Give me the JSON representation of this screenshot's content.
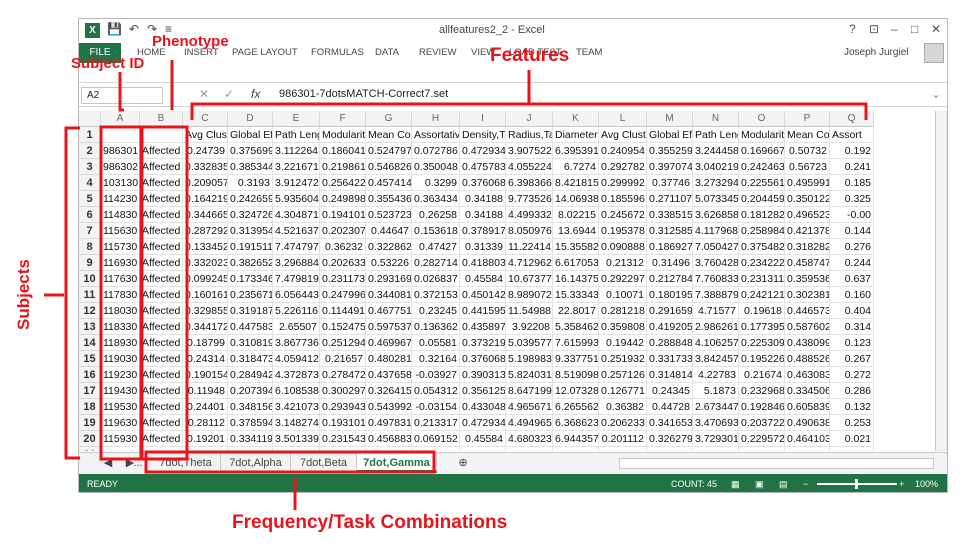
{
  "window": {
    "title": "allfeatures2_2 - Excel",
    "user": "Joseph Jurgiel",
    "controls": [
      "?",
      "⊡",
      "–",
      "□",
      "✕"
    ]
  },
  "quick_access": [
    "💾",
    "↶",
    "↷",
    "≡"
  ],
  "ribbon_tabs": [
    "FILE",
    "HOME",
    "INSERT",
    "PAGE LAYOUT",
    "FORMULAS",
    "DATA",
    "REVIEW",
    "VIEW",
    "LOAD TEST",
    "TEAM"
  ],
  "formula_bar": {
    "name_box": "A2",
    "fx": "fx",
    "value": "986301-7dotsMATCH-Correct7.set"
  },
  "columns": [
    "A",
    "B",
    "C",
    "D",
    "E",
    "F",
    "G",
    "H",
    "I",
    "J",
    "K",
    "L",
    "M",
    "N",
    "O",
    "P",
    "Q"
  ],
  "header_row": [
    "",
    "",
    "Avg Cluste",
    "Global Effi",
    "Path Lengt",
    "Modularity",
    "Mean Coh",
    "Assortativi",
    "Density,Ta",
    "Radius,Tas",
    "Diameter,",
    "Avg Cluste",
    "Global Effi",
    "Path Lengt",
    "Modularity",
    "Mean Coh",
    "Assort"
  ],
  "rows": [
    {
      "n": "2",
      "id": "986301",
      "ph": "Affected",
      "v": [
        "0.24739",
        "0.375699",
        "3.112264",
        "0.186041",
        "0.524797",
        "0.072786",
        "0.472934",
        "3.907522",
        "6.395391",
        "0.240954",
        "0.355259",
        "3.244458",
        "0.169667",
        "0.50732",
        "0.192"
      ]
    },
    {
      "n": "3",
      "id": "986302",
      "ph": "Affected",
      "v": [
        "0.332835",
        "0.385344",
        "3.221671",
        "0.219861",
        "0.546826",
        "0.350048",
        "0.475783",
        "4.055224",
        "6.7274",
        "0.292782",
        "0.397074",
        "3.040219",
        "0.242463",
        "0.56723",
        "0.241"
      ]
    },
    {
      "n": "4",
      "id": "103130",
      "ph": "Affected",
      "v": [
        "0.209057",
        "0.3193",
        "3.912472",
        "0.256422",
        "0.457414",
        "0.3299",
        "0.376068",
        "6.398366",
        "8.421815",
        "0.299992",
        "0.37746",
        "3.273294",
        "0.225561",
        "0.495991",
        "0.185"
      ]
    },
    {
      "n": "5",
      "id": "114230",
      "ph": "Affected",
      "v": [
        "0.164219",
        "0.242659",
        "5.935604",
        "0.249898",
        "0.355436",
        "0.363434",
        "0.34188",
        "9.773526",
        "14.06938",
        "0.185596",
        "0.271107",
        "5.073345",
        "0.204459",
        "0.350122",
        "0.325"
      ]
    },
    {
      "n": "6",
      "id": "114830",
      "ph": "Affected",
      "v": [
        "0.344665",
        "0.324726",
        "4.304871",
        "0.194101",
        "0.523723",
        "0.26258",
        "0.34188",
        "4.499332",
        "8.02215",
        "0.245672",
        "0.338515",
        "3.626858",
        "0.181282",
        "0.496523",
        "-0.00"
      ]
    },
    {
      "n": "7",
      "id": "115630",
      "ph": "Affected",
      "v": [
        "0.287292",
        "0.313954",
        "4.521637",
        "0.202307",
        "0.44647",
        "0.153618",
        "0.378917",
        "8.050976",
        "13.6944",
        "0.195378",
        "0.312585",
        "4.117968",
        "0.258984",
        "0.421378",
        "0.144"
      ]
    },
    {
      "n": "8",
      "id": "115730",
      "ph": "Affected",
      "v": [
        "0.133452",
        "0.191511",
        "7.474797",
        "0.36232",
        "0.322862",
        "0.47427",
        "0.31339",
        "11.22414",
        "15.35582",
        "0.090888",
        "0.186927",
        "7.050427",
        "0.375482",
        "0.318282",
        "0.276"
      ]
    },
    {
      "n": "9",
      "id": "116930",
      "ph": "Affected",
      "v": [
        "0.332023",
        "0.382652",
        "3.296884",
        "0.202633",
        "0.53226",
        "0.282714",
        "0.418803",
        "4.712962",
        "6.617053",
        "0.21312",
        "0.31496",
        "3.760428",
        "0.234222",
        "0.458747",
        "0.244"
      ]
    },
    {
      "n": "10",
      "id": "117630",
      "ph": "Affected",
      "v": [
        "0.099245",
        "0.173346",
        "7.479819",
        "0.231173",
        "0.293169",
        "0.026837",
        "0.45584",
        "10.67377",
        "16.14375",
        "0.292297",
        "0.212784",
        "7.760833",
        "0.231311",
        "0.359536",
        "0.637"
      ]
    },
    {
      "n": "11",
      "id": "117830",
      "ph": "Affected",
      "v": [
        "0.160161",
        "0.235671",
        "6.056443",
        "0.247996",
        "0.344081",
        "0.372153",
        "0.450142",
        "8.989072",
        "15.33343",
        "0.10071",
        "0.180195",
        "7.388879",
        "0.242121",
        "0.302381",
        "0.160"
      ]
    },
    {
      "n": "12",
      "id": "118030",
      "ph": "Affected",
      "v": [
        "0.329855",
        "0.319187",
        "5.226116",
        "0.114491",
        "0.467751",
        "0.23245",
        "0.441595",
        "11.54988",
        "22.8017",
        "0.281218",
        "0.291659",
        "4.71577",
        "0.19618",
        "0.446573",
        "0.404"
      ]
    },
    {
      "n": "13",
      "id": "118330",
      "ph": "Affected",
      "v": [
        "0.344172",
        "0.447583",
        "2.65507",
        "0.152475",
        "0.597537",
        "0.136362",
        "0.435897",
        "3.92208",
        "5.358462",
        "0.359808",
        "0.419205",
        "2.986261",
        "0.177395",
        "0.587602",
        "0.314"
      ]
    },
    {
      "n": "14",
      "id": "118930",
      "ph": "Affected",
      "v": [
        "0.18799",
        "0.310819",
        "3.867736",
        "0.251294",
        "0.469967",
        "0.05581",
        "0.373219",
        "5.039577",
        "7.615993",
        "0.19442",
        "0.288848",
        "4.106257",
        "0.225309",
        "0.438099",
        "0.123"
      ]
    },
    {
      "n": "15",
      "id": "119030",
      "ph": "Affected",
      "v": [
        "0.24314",
        "0.318473",
        "4.059412",
        "0.21657",
        "0.480281",
        "0.32164",
        "0.376068",
        "5.198983",
        "9.337751",
        "0.251932",
        "0.331733",
        "3.842457",
        "0.195226",
        "0.488526",
        "0.267"
      ]
    },
    {
      "n": "16",
      "id": "119230",
      "ph": "Affected",
      "v": [
        "0.190154",
        "0.284942",
        "4.372873",
        "0.278472",
        "0.437658",
        "-0.03927",
        "0.390313",
        "5.824031",
        "8.519098",
        "0.257126",
        "0.314814",
        "4.22783",
        "0.21674",
        "0.463083",
        "0.272"
      ]
    },
    {
      "n": "17",
      "id": "119430",
      "ph": "Affected",
      "v": [
        "0.11948",
        "0.207394",
        "6.108538",
        "0.300297",
        "0.326415",
        "0.054312",
        "0.356125",
        "8.647199",
        "12.07328",
        "0.126771",
        "0.24345",
        "5.1873",
        "0.232968",
        "0.334506",
        "0.286"
      ]
    },
    {
      "n": "18",
      "id": "119530",
      "ph": "Affected",
      "v": [
        "0.24401",
        "0.348156",
        "3.421073",
        "0.293943",
        "0.543992",
        "-0.03154",
        "0.433048",
        "4.965671",
        "6.265562",
        "0.36382",
        "0.44728",
        "2.673447",
        "0.192846",
        "0.605839",
        "0.132"
      ]
    },
    {
      "n": "19",
      "id": "119630",
      "ph": "Affected",
      "v": [
        "0.28112",
        "0.378594",
        "3.148274",
        "0.193101",
        "0.497831",
        "0.213317",
        "0.472934",
        "4.494965",
        "6.368623",
        "0.206233",
        "0.341653",
        "3.470693",
        "0.203722",
        "0.490638",
        "0.253"
      ]
    },
    {
      "n": "20",
      "id": "115930",
      "ph": "Affected",
      "v": [
        "0.19201",
        "0.334119",
        "3.501339",
        "0.231543",
        "0.456883",
        "0.069152",
        "0.45584",
        "4.680323",
        "6.944357",
        "0.201112",
        "0.326279",
        "3.729301",
        "0.229572",
        "0.464103",
        "0.021"
      ]
    },
    {
      "n": "21",
      "id": "115930",
      "ph": "Affected",
      "v": [
        "0.19201",
        "0.334119",
        "3.501339",
        "0.231543",
        "0.456883",
        "0.069152",
        "0.45584",
        "4.680323",
        "6.944357",
        "0.201112",
        "0.326279",
        "3.729301",
        "0.235904",
        "0.464103",
        "0.021"
      ]
    },
    {
      "n": "22",
      "id": "118830",
      "ph": "Affected",
      "v": [
        "0.237191",
        "0.336867",
        "3.684413",
        "0.221745",
        "0.504192",
        "0.23305",
        "0.387464",
        "5.771004",
        "7.236595",
        "0.290799",
        "0.327412",
        "3.970819",
        "0.249596",
        "0.501001",
        "0.321"
      ]
    },
    {
      "n": "23",
      "id": "118830",
      "ph": "Affected",
      "v": [
        "0.237191",
        "0.336867",
        "3.684413",
        "0.221745",
        "0.504192",
        "0.23305",
        "0.387464",
        "5.771004",
        "7.236595",
        "0.290799",
        "0.327412",
        "3.970819",
        "0.249596",
        "0.501001",
        "0.321"
      ]
    }
  ],
  "sheet_tabs": [
    {
      "label": "7dot,Theta",
      "active": false
    },
    {
      "label": "7dot,Alpha",
      "active": false
    },
    {
      "label": "7dot,Beta",
      "active": false
    },
    {
      "label": "7dot,Gamma",
      "active": true
    }
  ],
  "sheet_nav": {
    "ellipsis": "...",
    "add": "⊕"
  },
  "status": {
    "ready": "READY",
    "count": "COUNT: 45",
    "zoom": "100%"
  },
  "annotations": {
    "subject_id": "Subject ID",
    "phenotype": "Phenotype",
    "features": "Features",
    "subjects": "Subjects",
    "freq_task": "Frequency/Task Combinations",
    "color": "#e8141c"
  },
  "colors": {
    "excel_green": "#217346",
    "annotation_red": "#e8141c"
  }
}
